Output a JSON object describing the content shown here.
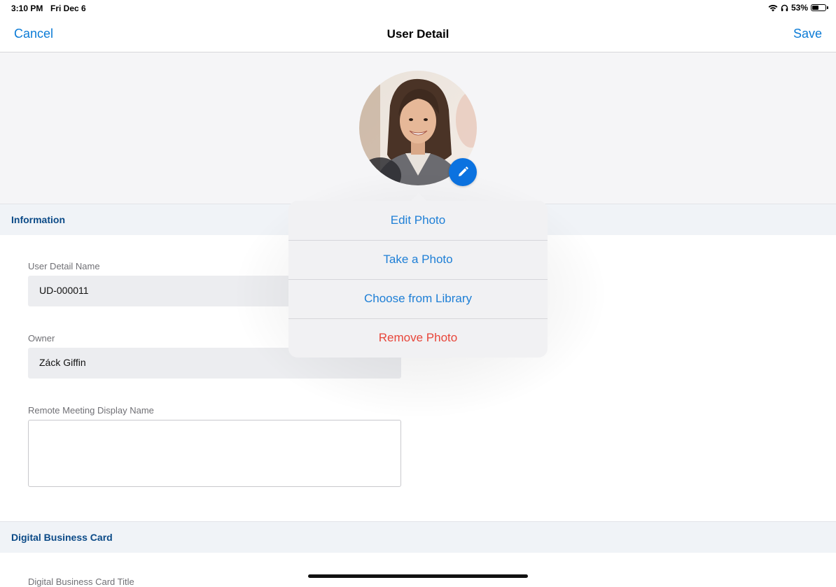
{
  "status_bar": {
    "time": "3:10 PM",
    "date": "Fri Dec 6",
    "battery_percent": "53%",
    "battery_level": 0.53,
    "icons": [
      "wifi-icon",
      "headphones-icon",
      "battery-icon"
    ]
  },
  "nav": {
    "cancel_label": "Cancel",
    "title": "User Detail",
    "save_label": "Save"
  },
  "photo": {
    "edit_icon": "pencil-icon"
  },
  "sections": {
    "information": "Information",
    "digital_business_card": "Digital Business Card"
  },
  "fields": {
    "user_detail_name": {
      "label": "User Detail Name",
      "value": "UD-000011"
    },
    "owner": {
      "label": "Owner",
      "value": "Záck Giffin"
    },
    "remote_meeting_display_name": {
      "label": "Remote Meeting Display Name",
      "value": ""
    },
    "digital_business_card_title": {
      "label": "Digital Business Card Title"
    }
  },
  "popover": {
    "items": [
      {
        "label": "Edit Photo"
      },
      {
        "label": "Take a Photo"
      },
      {
        "label": "Choose from Library"
      },
      {
        "label": "Remove Photo"
      }
    ]
  },
  "colors": {
    "accent": "#0b7bd6",
    "destructive": "#e8463a",
    "section_title": "#0b4a87",
    "badge": "#0b72e0"
  }
}
